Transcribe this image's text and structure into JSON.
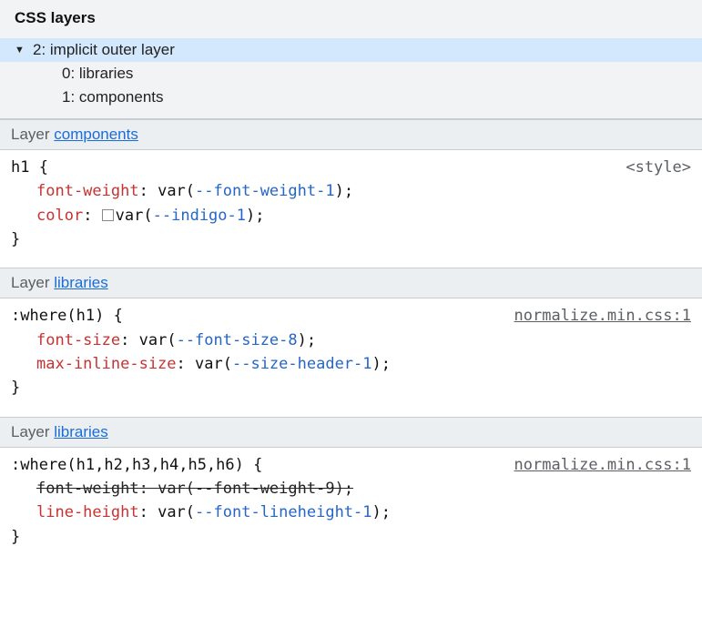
{
  "panel": {
    "title": "CSS layers"
  },
  "tree": {
    "items": [
      {
        "label": "2: implicit outer layer",
        "depth": 0,
        "expanded": true,
        "selected": true
      },
      {
        "label": "0: libraries",
        "depth": 1,
        "expanded": false,
        "selected": false
      },
      {
        "label": "1: components",
        "depth": 1,
        "expanded": false,
        "selected": false
      }
    ]
  },
  "sections": [
    {
      "layer_prefix": "Layer ",
      "layer_link": "components",
      "selector": "h1",
      "source": "<style>",
      "source_underline": false,
      "declarations": [
        {
          "prop": "font-weight",
          "func": "var",
          "var": "--font-weight-1",
          "swatch": false,
          "struck": false
        },
        {
          "prop": "color",
          "func": "var",
          "var": "--indigo-1",
          "swatch": true,
          "struck": false
        }
      ]
    },
    {
      "layer_prefix": "Layer ",
      "layer_link": "libraries",
      "selector": ":where(h1)",
      "source": "normalize.min.css:1",
      "source_underline": true,
      "declarations": [
        {
          "prop": "font-size",
          "func": "var",
          "var": "--font-size-8",
          "swatch": false,
          "struck": false
        },
        {
          "prop": "max-inline-size",
          "func": "var",
          "var": "--size-header-1",
          "swatch": false,
          "struck": false
        }
      ]
    },
    {
      "layer_prefix": "Layer ",
      "layer_link": "libraries",
      "selector": ":where(h1,h2,h3,h4,h5,h6)",
      "source": "normalize.min.css:1",
      "source_underline": true,
      "declarations": [
        {
          "prop": "font-weight",
          "func": "var",
          "var": "--font-weight-9",
          "swatch": false,
          "struck": true
        },
        {
          "prop": "line-height",
          "func": "var",
          "var": "--font-lineheight-1",
          "swatch": false,
          "struck": false
        }
      ]
    }
  ]
}
